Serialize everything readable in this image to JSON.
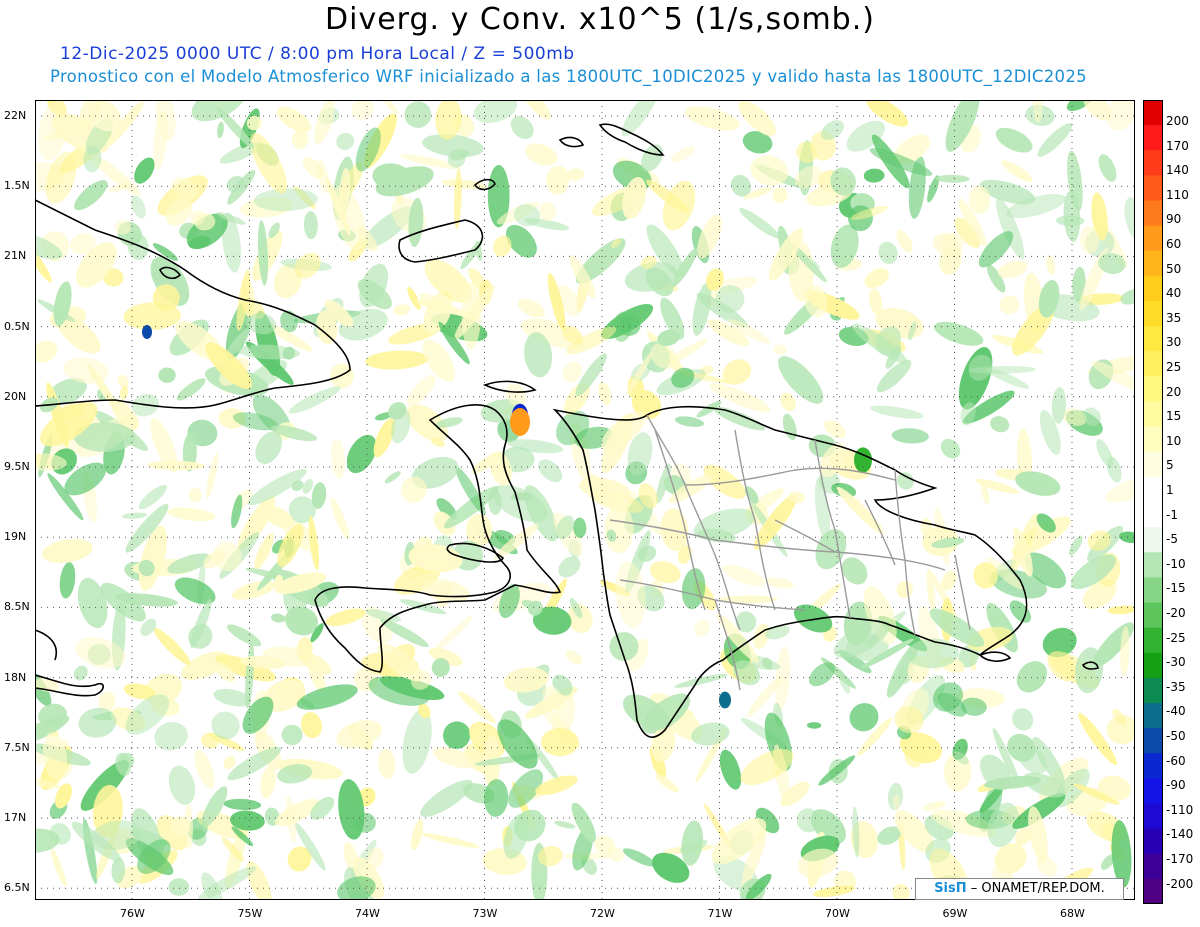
{
  "header": {
    "title": "Diverg. y Conv. x10^5 (1/s,somb.)",
    "subtitle_line1": "12-Dic-2025  0000 UTC / 8:00 pm Hora Local / Z = 500mb",
    "subtitle_line2": "Pronostico con el Modelo Atmosferico WRF inicializado a las 1800UTC_10DIC2025 y valido hasta las  1800UTC_12DIC2025"
  },
  "map": {
    "lat_labels": [
      "22N",
      "1.5N",
      "21N",
      "0.5N",
      "20N",
      "9.5N",
      "19N",
      "8.5N",
      "18N",
      "7.5N",
      "17N",
      "6.5N"
    ],
    "lon_labels": [
      "76W",
      "75W",
      "74W",
      "73W",
      "72W",
      "71W",
      "70W",
      "69W",
      "68W"
    ],
    "background_colors": {
      "green": "#5fc86f",
      "light_green": "#b5e6b5",
      "yellow": "#fff59a",
      "light_yellow": "#fffac8"
    }
  },
  "colorbar": {
    "levels": [
      "200",
      "170",
      "140",
      "110",
      "90",
      "60",
      "50",
      "40",
      "35",
      "30",
      "25",
      "20",
      "15",
      "10",
      "5",
      "1",
      "-1",
      "-5",
      "-10",
      "-15",
      "-20",
      "-25",
      "-30",
      "-35",
      "-40",
      "-50",
      "-60",
      "-90",
      "-110",
      "-140",
      "-170",
      "-200"
    ],
    "colors": [
      "#e00000",
      "#ff1a1a",
      "#ff3b1a",
      "#ff5a1a",
      "#ff7a1a",
      "#ff9a1a",
      "#ffb41a",
      "#ffcc1a",
      "#ffdc28",
      "#ffe840",
      "#fff060",
      "#fff880",
      "#fffb9e",
      "#fffdbf",
      "#fffee0",
      "#ffffff",
      "#ffffff",
      "#eef8ee",
      "#b5e6b5",
      "#86d686",
      "#5cc65c",
      "#32b432",
      "#14a014",
      "#0c8c50",
      "#0c6e8c",
      "#0a4aa8",
      "#0a28d2",
      "#1414e6",
      "#1e0ad2",
      "#2800b4",
      "#3c0096",
      "#500082"
    ]
  },
  "credit": {
    "logo": "SisΠ",
    "text": "– ONAMET/REP.DOM."
  }
}
